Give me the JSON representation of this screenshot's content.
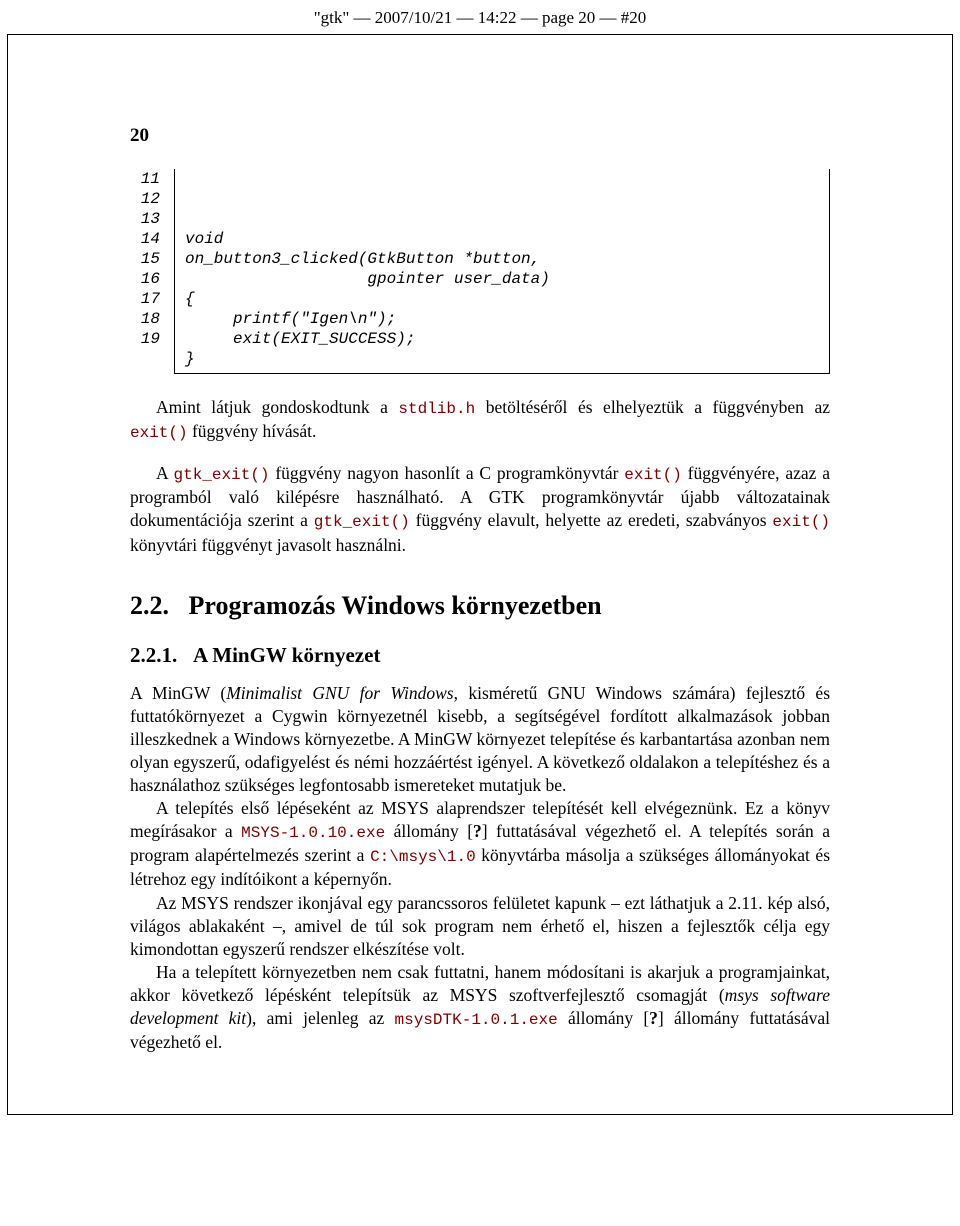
{
  "header": "\"gtk\" — 2007/10/21 — 14:22 — page 20 — #20",
  "page_number": "20",
  "code": {
    "lines": [
      {
        "n": "11",
        "c": ""
      },
      {
        "n": "12",
        "c": ""
      },
      {
        "n": "13",
        "c": "void"
      },
      {
        "n": "14",
        "c": "on_button3_clicked(GtkButton *button,"
      },
      {
        "n": "15",
        "c": "                   gpointer user_data)"
      },
      {
        "n": "16",
        "c": "{"
      },
      {
        "n": "17",
        "c": "     printf(\"Igen\\n\");"
      },
      {
        "n": "18",
        "c": "     exit(EXIT_SUCCESS);"
      },
      {
        "n": "19",
        "c": "}"
      }
    ]
  },
  "para1": {
    "t1": "Amint látjuk gondoskodtunk a ",
    "c1": "stdlib.h",
    "t2": " betöltéséről és elhelyeztük a függvényben az ",
    "c2": "exit()",
    "t3": " függvény hívását."
  },
  "para2": {
    "t1": "A ",
    "c1": "gtk_exit()",
    "t2": " függvény nagyon hasonlít a C programkönyvtár ",
    "c2": "exit()",
    "t3": " függvényére, azaz a programból való kilépésre használható. A GTK programkönyvtár újabb változatainak dokumentációja szerint a ",
    "c3": "gtk_exit()",
    "t4": " függvény elavult, helyette az eredeti, szabványos ",
    "c4": "exit()",
    "t5": " könyvtári függvényt javasolt használni."
  },
  "section": {
    "num": "2.2.",
    "title": "Programozás Windows környezetben"
  },
  "subsection": {
    "num": "2.2.1.",
    "title": "A MinGW környezet"
  },
  "para3": {
    "t1": "A MinGW (",
    "i1": "Minimalist GNU for Windows",
    "t2": ", kisméretű GNU Windows számára) fejlesztő és futtatókörnyezet a Cygwin környezetnél kisebb, a segítségével fordított alkalmazások jobban illeszkednek a Windows környezetbe. A MinGW környezet telepítése és karbantartása azonban nem olyan egyszerű, odafigyelést és némi hozzáértést igényel. A következő oldalakon a telepítéshez és a használathoz szükséges legfontosabb ismereteket mutatjuk be."
  },
  "para4": {
    "t1": "A telepítés első lépéseként az MSYS alaprendszer telepítését kell elvégeznünk. Ez a könyv megírásakor a ",
    "c1": "MSYS-1.0.10.exe",
    "t2": " állomány [",
    "b1": "?",
    "t3": "] futtatásával végezhető el. A telepítés során a program alapértelmezés szerint a ",
    "c2": "C:\\msys\\1.0",
    "t4": " könyvtárba másolja a szükséges állományokat és létrehoz egy indítóikont a képernyőn."
  },
  "para5": "Az MSYS rendszer ikonjával egy parancssoros felületet kapunk – ezt láthatjuk a 2.11. kép alsó, világos ablakaként –, amivel de túl sok program nem érhető el, hiszen a fejlesztők célja egy kimondottan egyszerű rendszer elkészítése volt.",
  "para6": {
    "t1": "Ha a telepített környezetben nem csak futtatni, hanem módosítani is akarjuk a programjainkat, akkor következő lépésként telepítsük az MSYS szoftverfejlesztő csomagját (",
    "i1": "msys software development kit",
    "t2": "), ami jelenleg az ",
    "c1": "msysDTK-1.0.1.exe",
    "t3": " állomány [",
    "b1": "?",
    "t4": "] állomány futtatásával végezhető el."
  }
}
